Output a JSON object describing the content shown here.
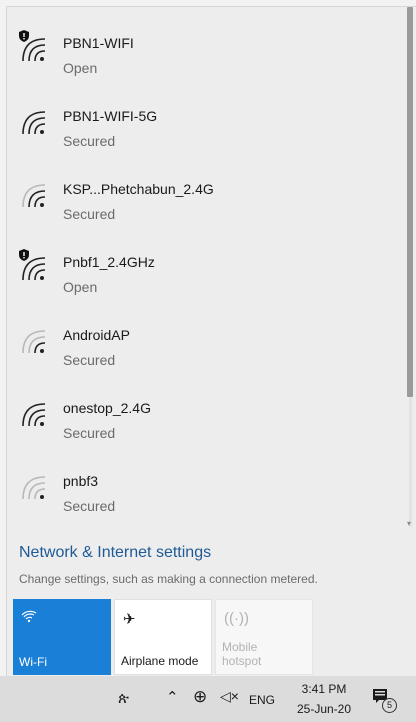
{
  "networks": [
    {
      "name": "PBN1-WIFI",
      "status": "Open",
      "icon": "wifi-warning-icon",
      "signal": 4,
      "shield": true
    },
    {
      "name": "PBN1-WIFI-5G",
      "status": "Secured",
      "icon": "wifi-icon",
      "signal": 4,
      "shield": false
    },
    {
      "name": "KSP...Phetchabun_2.4G",
      "status": "Secured",
      "icon": "wifi-icon",
      "signal": 3,
      "shield": false
    },
    {
      "name": "Pnbf1_2.4GHz",
      "status": "Open",
      "icon": "wifi-warning-icon",
      "signal": 4,
      "shield": true
    },
    {
      "name": "AndroidAP",
      "status": "Secured",
      "icon": "wifi-icon",
      "signal": 2,
      "shield": false
    },
    {
      "name": "onestop_2.4G",
      "status": "Secured",
      "icon": "wifi-icon",
      "signal": 4,
      "shield": false
    },
    {
      "name": "pnbf3",
      "status": "Secured",
      "icon": "wifi-icon",
      "signal": 1,
      "shield": false
    }
  ],
  "settings": {
    "link": "Network & Internet settings",
    "sub": "Change settings, such as making a connection metered."
  },
  "quick_actions": {
    "wifi": {
      "label": "Wi-Fi",
      "icon": "wifi-icon",
      "active": true
    },
    "airplane": {
      "label": "Airplane mode",
      "icon": "airplane-icon",
      "active": false
    },
    "hotspot": {
      "label1": "Mobile",
      "label2": "hotspot",
      "icon": "hotspot-icon",
      "disabled": true
    }
  },
  "taskbar": {
    "language": "ENG",
    "time": "3:41 PM",
    "date": "25-Jun-20",
    "notification_count": "5"
  },
  "colors": {
    "accent": "#1a7fd6",
    "link": "#1f5a96"
  }
}
